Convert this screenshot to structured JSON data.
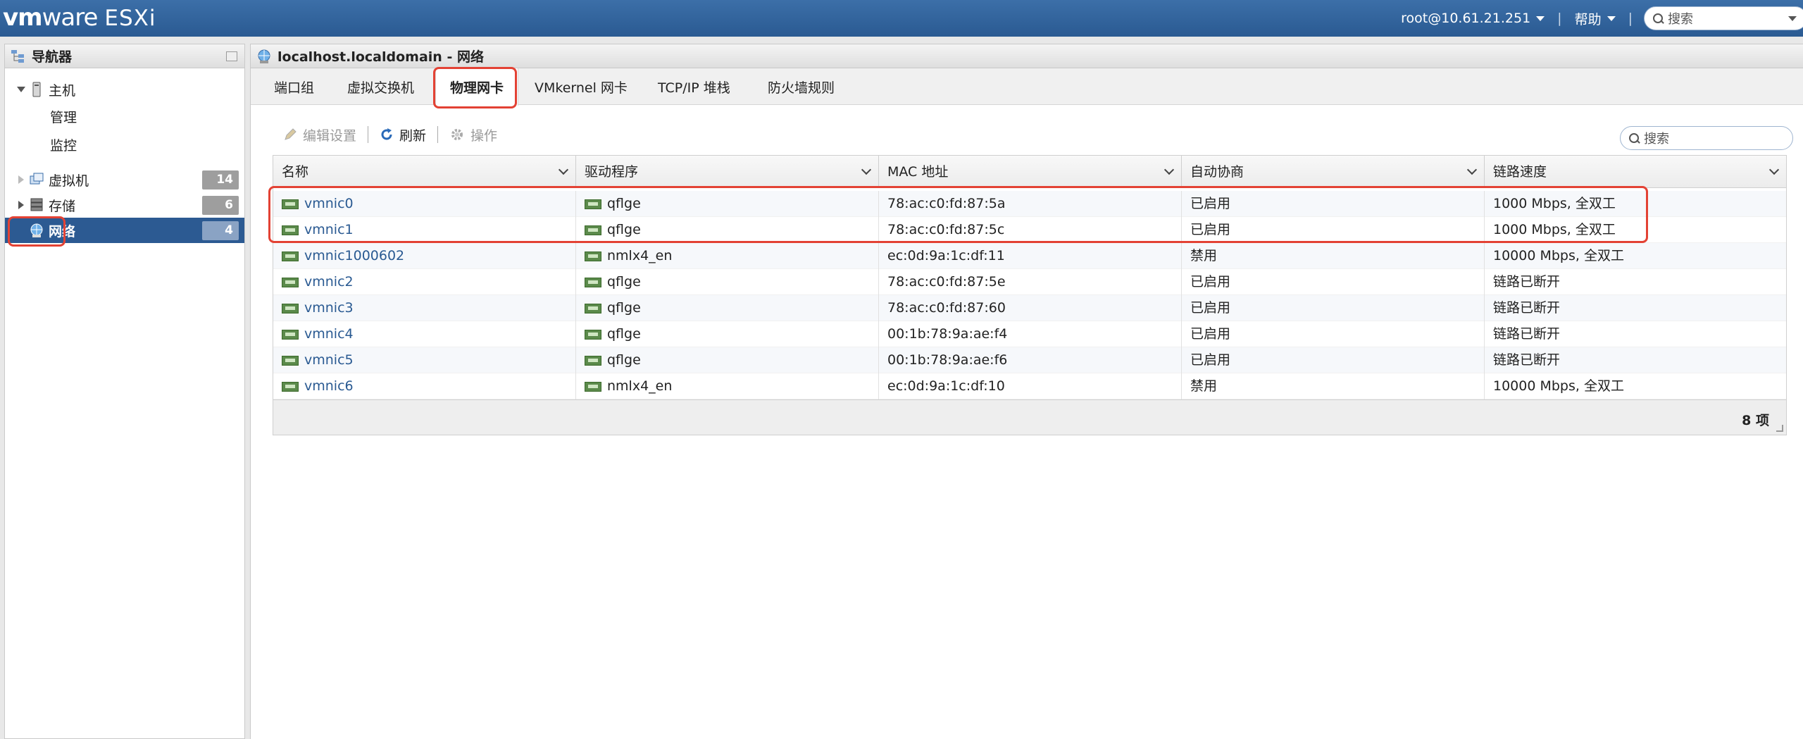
{
  "header": {
    "brand_vm": "vm",
    "brand_ware": "ware",
    "brand_product": "ESXi",
    "user": "root@10.61.21.251",
    "help": "帮助",
    "search_placeholder": "搜索"
  },
  "navigator": {
    "title": "导航器",
    "host": {
      "label": "主机",
      "children": [
        "管理",
        "监控"
      ]
    },
    "items": [
      {
        "label": "虚拟机",
        "count": "14"
      },
      {
        "label": "存储",
        "count": "6"
      },
      {
        "label": "网络",
        "count": "4",
        "selected": true
      }
    ]
  },
  "main": {
    "title": "localhost.localdomain - 网络",
    "tabs": [
      "端口组",
      "虚拟交换机",
      "物理网卡",
      "VMkernel 网卡",
      "TCP/IP 堆栈",
      "防火墙规则"
    ],
    "active_tab": "物理网卡",
    "toolbar": {
      "edit": "编辑设置",
      "refresh": "刷新",
      "actions": "操作"
    },
    "search_placeholder": "搜索",
    "columns": [
      "名称",
      "驱动程序",
      "MAC 地址",
      "自动协商",
      "链路速度"
    ],
    "rows": [
      {
        "name": "vmnic0",
        "driver": "qflge",
        "mac": "78:ac:c0:fd:87:5a",
        "auto": "已启用",
        "speed": "1000 Mbps, 全双工"
      },
      {
        "name": "vmnic1",
        "driver": "qflge",
        "mac": "78:ac:c0:fd:87:5c",
        "auto": "已启用",
        "speed": "1000 Mbps, 全双工"
      },
      {
        "name": "vmnic1000602",
        "driver": "nmlx4_en",
        "mac": "ec:0d:9a:1c:df:11",
        "auto": "禁用",
        "speed": "10000 Mbps, 全双工"
      },
      {
        "name": "vmnic2",
        "driver": "qflge",
        "mac": "78:ac:c0:fd:87:5e",
        "auto": "已启用",
        "speed": "链路已断开"
      },
      {
        "name": "vmnic3",
        "driver": "qflge",
        "mac": "78:ac:c0:fd:87:60",
        "auto": "已启用",
        "speed": "链路已断开"
      },
      {
        "name": "vmnic4",
        "driver": "qflge",
        "mac": "00:1b:78:9a:ae:f4",
        "auto": "已启用",
        "speed": "链路已断开"
      },
      {
        "name": "vmnic5",
        "driver": "qflge",
        "mac": "00:1b:78:9a:ae:f6",
        "auto": "已启用",
        "speed": "链路已断开"
      },
      {
        "name": "vmnic6",
        "driver": "nmlx4_en",
        "mac": "ec:0d:9a:1c:df:10",
        "auto": "禁用",
        "speed": "10000 Mbps, 全双工"
      }
    ],
    "count": "8 项"
  },
  "colors": {
    "topbar": "#2a5a92",
    "selected": "#2c5a92",
    "highlight": "#e34234",
    "link": "#2a5a92"
  }
}
